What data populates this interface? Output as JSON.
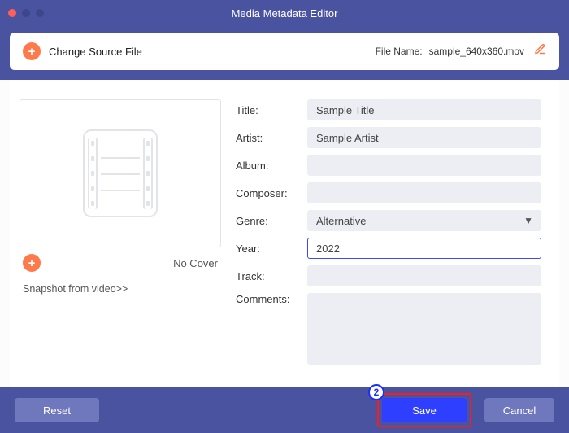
{
  "window": {
    "title": "Media Metadata Editor"
  },
  "header": {
    "change_source": "Change Source File",
    "filename_label": "File Name:",
    "filename_value": "sample_640x360.mov"
  },
  "cover": {
    "no_cover": "No Cover",
    "snapshot": "Snapshot from video>>"
  },
  "fields": {
    "title_label": "Title:",
    "title_value": "Sample Title",
    "artist_label": "Artist:",
    "artist_value": "Sample Artist",
    "album_label": "Album:",
    "album_value": "",
    "composer_label": "Composer:",
    "composer_value": "",
    "genre_label": "Genre:",
    "genre_value": "Alternative",
    "year_label": "Year:",
    "year_value": "2022",
    "track_label": "Track:",
    "track_value": "",
    "comments_label": "Comments:",
    "comments_value": ""
  },
  "footer": {
    "reset": "Reset",
    "save": "Save",
    "cancel": "Cancel",
    "callout": "2"
  }
}
